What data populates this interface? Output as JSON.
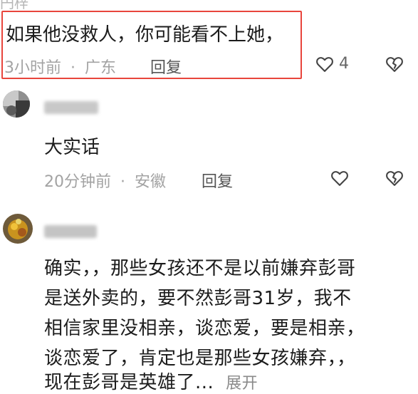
{
  "comment1": {
    "author": "円梓",
    "text": "如果他没救人，你可能看不上她，",
    "time": "3小时前",
    "separator": "·",
    "location": "广东",
    "reply_label": "回复",
    "like_count": "4"
  },
  "comment2": {
    "text": "大实话",
    "time": "20分钟前",
    "separator": "·",
    "location": "安徽",
    "reply_label": "回复"
  },
  "comment3": {
    "lines": [
      "确实，，那些女孩还不是以前嫌弃彭哥",
      "是送外卖的，要不然彭哥31岁，我不",
      "相信家里没相亲，谈恋爱，要是相亲，",
      "谈恋爱了，肯定也是那些女孩嫌弃，，",
      "现在彭哥是英雄了..."
    ],
    "expand_label": "展开"
  },
  "colors": {
    "highlight_border": "#e8453c",
    "text_primary": "#1c1c1c",
    "text_meta": "#a3a3a3"
  },
  "icons": [
    "heart-outline-icon",
    "dislike-heart-icon"
  ]
}
